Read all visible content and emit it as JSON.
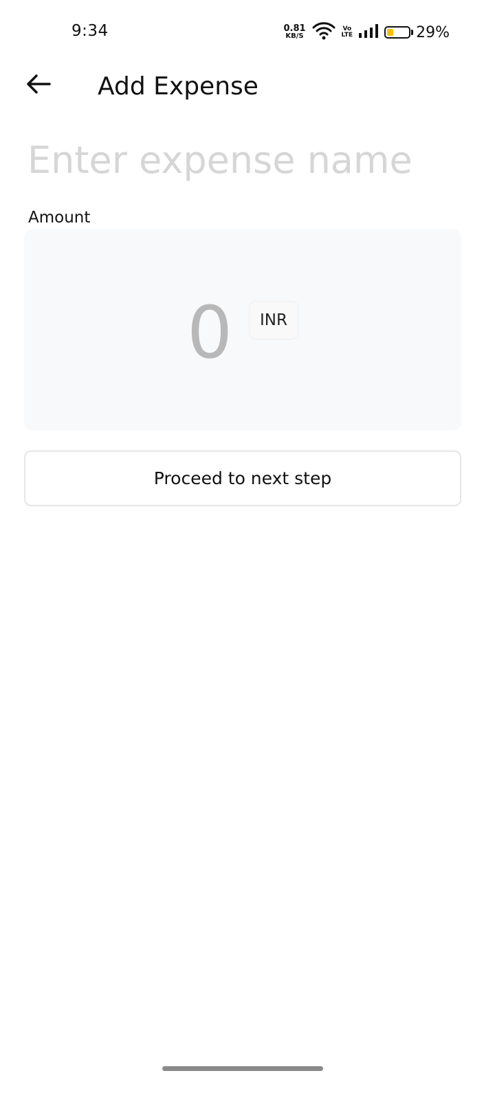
{
  "status_bar": {
    "time": "9:34",
    "net_speed_value": "0.81",
    "net_speed_unit": "KB/S",
    "volte_top": "Vo",
    "volte_bottom": "LTE",
    "battery_percent": "29%",
    "battery_level": 0.29,
    "battery_color": "#f5c000"
  },
  "header": {
    "back_icon": "arrow-left-icon",
    "title": "Add Expense"
  },
  "expense_name": {
    "value": "",
    "placeholder": "Enter expense name"
  },
  "amount": {
    "label": "Amount",
    "value": "0",
    "currency": "INR"
  },
  "actions": {
    "proceed_label": "Proceed to next step"
  }
}
